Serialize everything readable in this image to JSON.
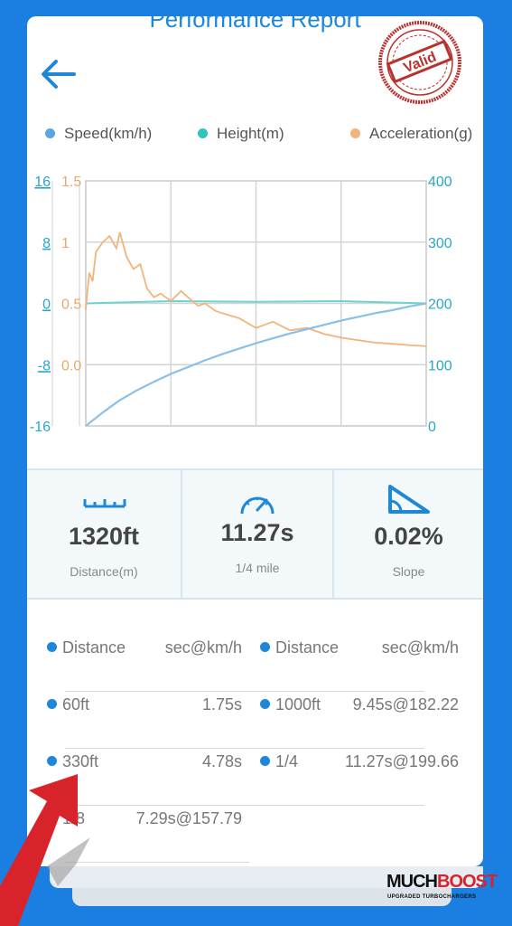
{
  "header": {
    "title": "Performance Report",
    "stamp_text": "Valid"
  },
  "legend": [
    {
      "label": "Speed(km/h)",
      "color": "#5aa6e0"
    },
    {
      "label": "Height(m)",
      "color": "#2ec4c0"
    },
    {
      "label": "Acceleration(g)",
      "color": "#f2b47a"
    }
  ],
  "chart_data": {
    "type": "line",
    "left_axis_height": {
      "ticks": [
        "16",
        "8",
        "0",
        "-8",
        "-16"
      ],
      "color": "#2aa6c8"
    },
    "left_axis_accel": {
      "ticks": [
        "1.5",
        "1",
        "0.5",
        "0.0"
      ],
      "color": "#e9a96a"
    },
    "right_axis_speed": {
      "ticks": [
        "400",
        "300",
        "200",
        "100",
        "0"
      ],
      "color": "#2aa6c8"
    },
    "speed_range": [
      0,
      400
    ],
    "height_range": [
      -16,
      16
    ],
    "accel_range": [
      -0.5,
      1.5
    ],
    "grid": true,
    "series": [
      {
        "name": "Speed(km/h)",
        "color": "#8ac0e6",
        "x": [
          0,
          0.05,
          0.1,
          0.15,
          0.2,
          0.25,
          0.3,
          0.35,
          0.4,
          0.45,
          0.5,
          0.55,
          0.6,
          0.65,
          0.7,
          0.75,
          0.8,
          0.85,
          0.9,
          0.95,
          1.0
        ],
        "values": [
          0,
          22,
          42,
          58,
          72,
          85,
          96,
          107,
          117,
          126,
          135,
          143,
          151,
          158,
          165,
          172,
          178,
          184,
          189,
          195,
          200
        ]
      },
      {
        "name": "Height(m)",
        "color": "#6ed3d0",
        "x": [
          0,
          0.25,
          0.5,
          0.75,
          1.0
        ],
        "values": [
          0,
          0.3,
          0.2,
          0.3,
          0
        ]
      },
      {
        "name": "Acceleration(g)",
        "color": "#f2b47a",
        "x": [
          0,
          0.01,
          0.02,
          0.03,
          0.05,
          0.07,
          0.09,
          0.1,
          0.12,
          0.14,
          0.16,
          0.18,
          0.2,
          0.22,
          0.25,
          0.28,
          0.3,
          0.33,
          0.35,
          0.38,
          0.4,
          0.45,
          0.5,
          0.55,
          0.6,
          0.65,
          0.7,
          0.75,
          0.8,
          0.85,
          0.9,
          0.95,
          1.0
        ],
        "values": [
          0.45,
          0.75,
          0.68,
          0.92,
          1.0,
          1.05,
          0.95,
          1.08,
          0.88,
          0.78,
          0.82,
          0.62,
          0.55,
          0.58,
          0.52,
          0.6,
          0.55,
          0.48,
          0.5,
          0.44,
          0.42,
          0.38,
          0.3,
          0.35,
          0.28,
          0.3,
          0.25,
          0.22,
          0.2,
          0.18,
          0.17,
          0.16,
          0.15
        ]
      }
    ]
  },
  "stats": [
    {
      "value": "1320ft",
      "sub": "Distance(m)",
      "icon": "ruler-icon"
    },
    {
      "value": "11.27s",
      "sub": "1/4 mile",
      "icon": "speedometer-icon"
    },
    {
      "value": "0.02%",
      "sub": "Slope",
      "icon": "slope-icon"
    }
  ],
  "table": {
    "headers": [
      {
        "label": "Distance",
        "value": "sec@km/h"
      },
      {
        "label": "Distance",
        "value": "sec@km/h"
      }
    ],
    "rows_left": [
      {
        "label": "60ft",
        "value": "1.75s"
      },
      {
        "label": "330ft",
        "value": "4.78s"
      },
      {
        "label": "1/8",
        "value": "7.29s@157.79"
      }
    ],
    "rows_right": [
      {
        "label": "1000ft",
        "value": "9.45s@182.22"
      },
      {
        "label": "1/4",
        "value": "11.27s@199.66"
      }
    ]
  },
  "brand": {
    "name_a": "MUCH",
    "name_b": "BOOST",
    "tagline": "UPGRADED TURBOCHARGERS"
  }
}
